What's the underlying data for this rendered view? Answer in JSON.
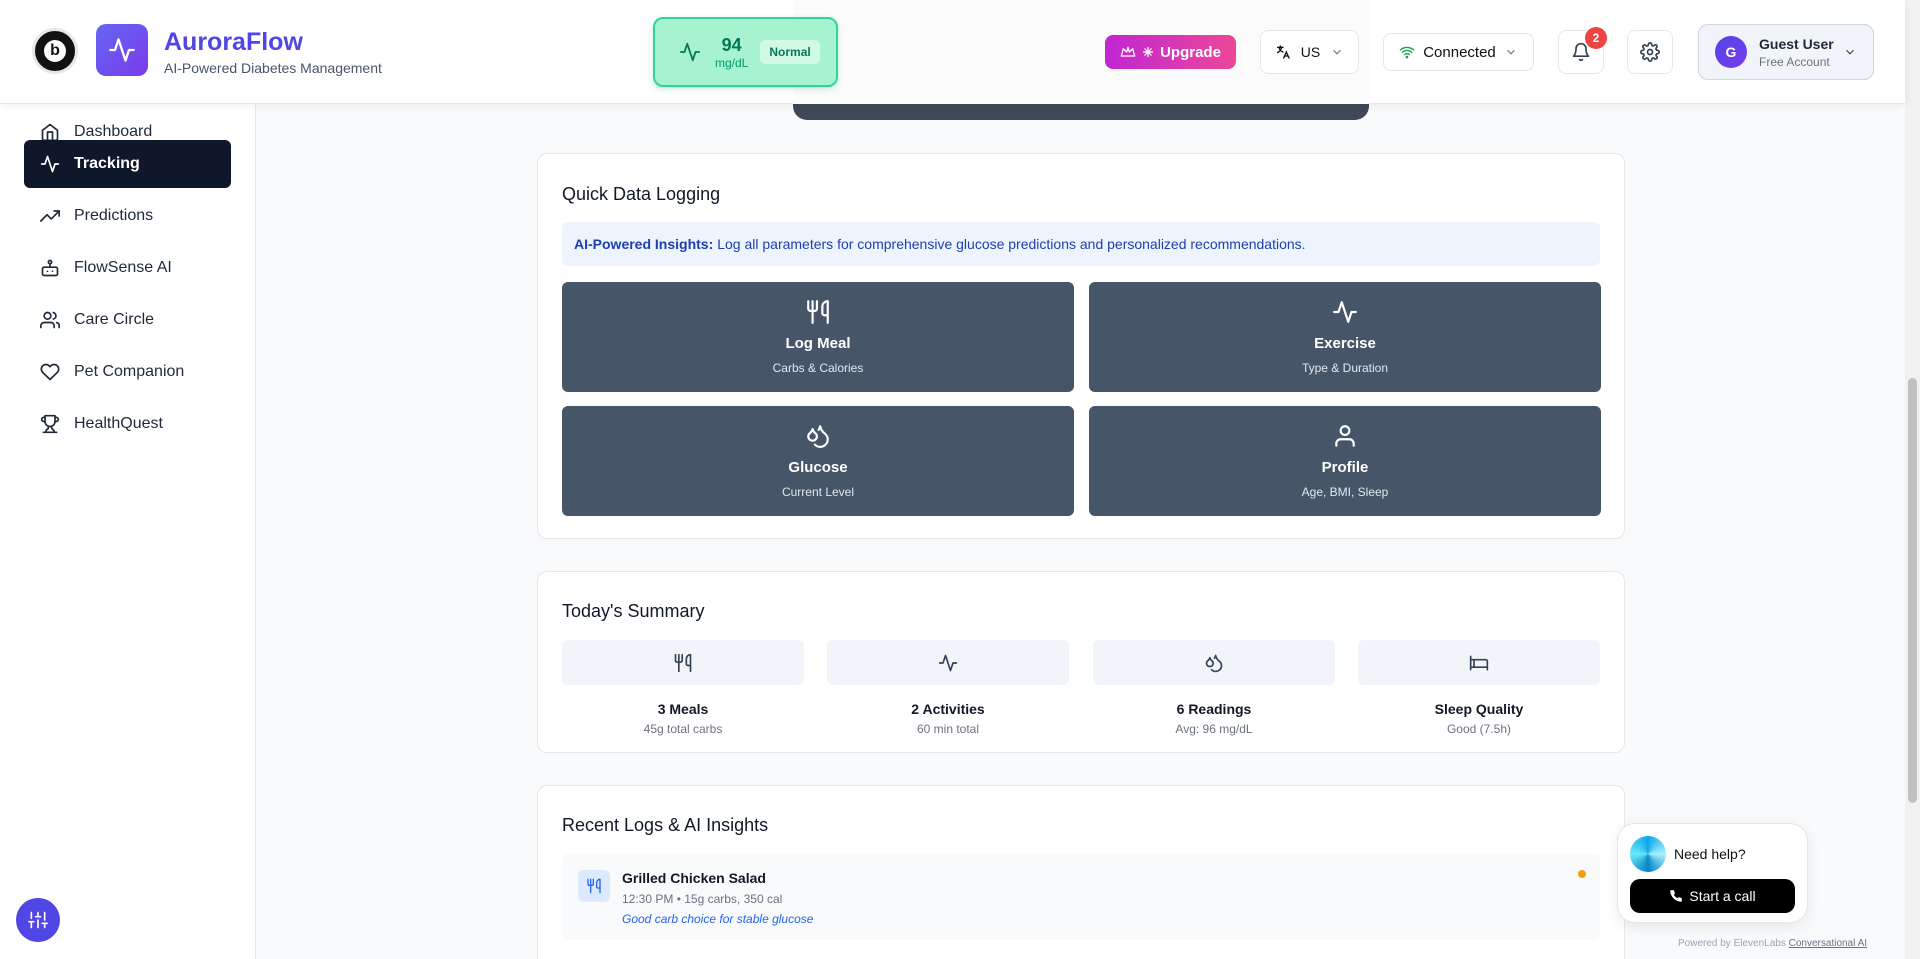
{
  "header": {
    "logo_letter": "b",
    "app_name": "AuroraFlow",
    "app_subtitle": "AI-Powered Diabetes Management",
    "glucose": {
      "value": "94",
      "unit": "mg/dL",
      "status": "Normal"
    },
    "upgrade_label": "Upgrade",
    "language": "US",
    "connection": "Connected",
    "notification_count": "2",
    "user": {
      "initial": "G",
      "name": "Guest User",
      "plan": "Free Account"
    }
  },
  "sidebar": {
    "items": [
      {
        "label": "Dashboard",
        "icon": "home-icon"
      },
      {
        "label": "Tracking",
        "icon": "activity-icon",
        "active": true
      },
      {
        "label": "Predictions",
        "icon": "trending-up-icon"
      },
      {
        "label": "FlowSense AI",
        "icon": "bot-icon"
      },
      {
        "label": "Care Circle",
        "icon": "users-icon"
      },
      {
        "label": "Pet Companion",
        "icon": "heart-icon"
      },
      {
        "label": "HealthQuest",
        "icon": "trophy-icon"
      }
    ]
  },
  "quick_logging": {
    "title": "Quick Data Logging",
    "insight_bold": "AI-Powered Insights:",
    "insight_text": "Log all parameters for comprehensive glucose predictions and personalized recommendations.",
    "tiles": [
      {
        "label": "Log Meal",
        "sub": "Carbs & Calories",
        "icon": "utensils-icon"
      },
      {
        "label": "Exercise",
        "sub": "Type & Duration",
        "icon": "activity-icon"
      },
      {
        "label": "Glucose",
        "sub": "Current Level",
        "icon": "droplets-icon"
      },
      {
        "label": "Profile",
        "sub": "Age, BMI, Sleep",
        "icon": "user-icon"
      }
    ]
  },
  "summary": {
    "title": "Today's Summary",
    "items": [
      {
        "label": "3 Meals",
        "sub": "45g total carbs",
        "icon": "utensils-icon"
      },
      {
        "label": "2 Activities",
        "sub": "60 min total",
        "icon": "activity-icon"
      },
      {
        "label": "6 Readings",
        "sub": "Avg: 96 mg/dL",
        "icon": "droplets-icon"
      },
      {
        "label": "Sleep Quality",
        "sub": "Good (7.5h)",
        "icon": "bed-icon"
      }
    ]
  },
  "recent": {
    "title": "Recent Logs & AI Insights",
    "logs": [
      {
        "title": "Grilled Chicken Salad",
        "meta": "12:30 PM • 15g carbs, 350 cal",
        "ai": "Good carb choice for stable glucose",
        "icon": "utensils-icon"
      }
    ]
  },
  "help_widget": {
    "prompt": "Need help?",
    "call_label": "Start a call",
    "powered_prefix": "Powered by ElevenLabs",
    "powered_link": "Conversational AI"
  },
  "colors": {
    "brand": "#4f46e5",
    "active_nav": "#0f172a",
    "tile_bg": "#475569",
    "glucose_ok": "#34d399",
    "upgrade_gradient": [
      "#c026d3",
      "#ec4899"
    ]
  }
}
